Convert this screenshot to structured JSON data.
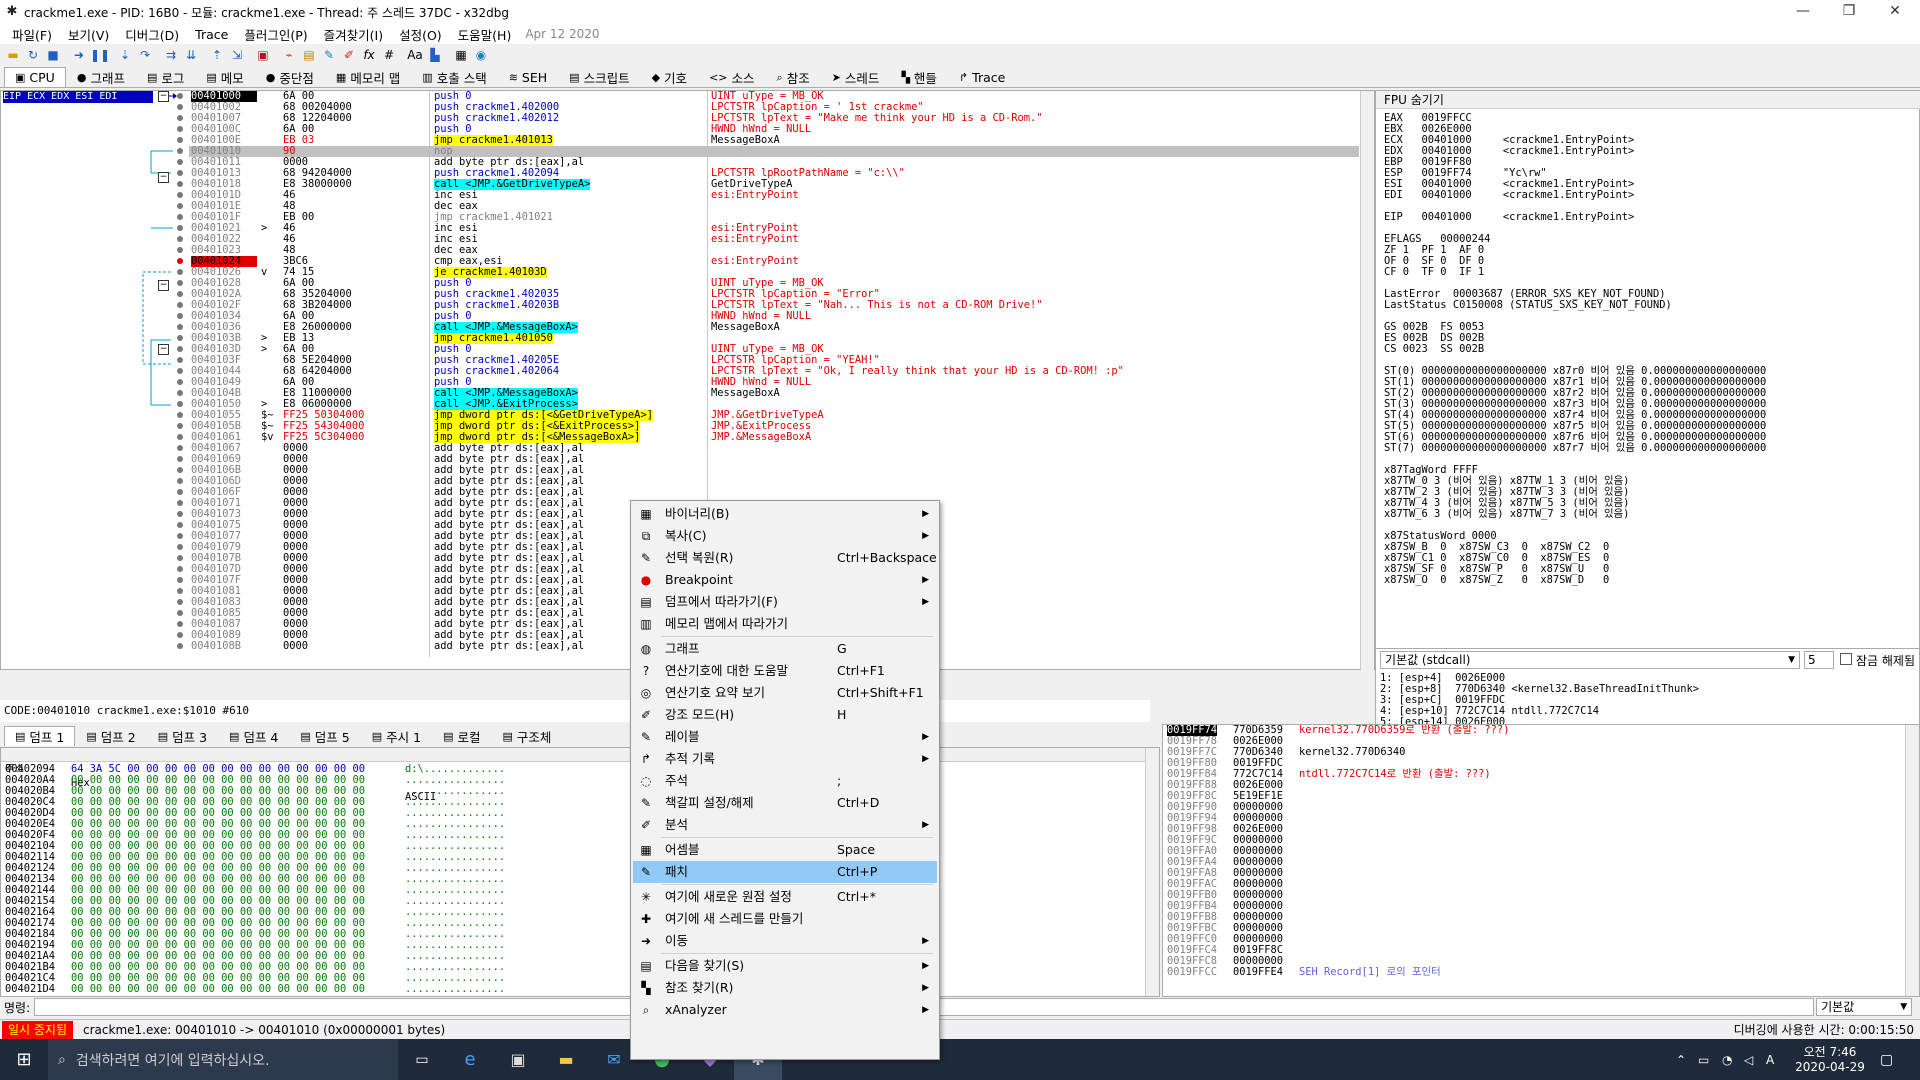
{
  "window": {
    "title": "crackme1.exe - PID: 16B0 - 모듈: crackme1.exe - Thread: 주 스레드 37DC - x32dbg",
    "min": "—",
    "max": "❐",
    "close": "✕"
  },
  "menu": {
    "items": [
      "파일(F)",
      "보기(V)",
      "디버그(D)",
      "Trace",
      "플러그인(P)",
      "즐겨찾기(I)",
      "설정(O)",
      "도움말(H)"
    ],
    "date": "Apr 12 2020"
  },
  "toolbar_icons": [
    "open-icon",
    "restart-icon",
    "stop-icon",
    "run-icon",
    "pause-icon",
    "step-into-icon",
    "step-over-icon",
    "trace-into-icon",
    "trace-over-icon",
    "execute-till-return-icon",
    "run-to-user-code-icon",
    "stop-sign-icon",
    "link-icon",
    "script-icon",
    "comment-icon",
    "label-icon",
    "function-icon",
    "hash-icon",
    "font-icon",
    "module-icon",
    "calc-icon",
    "globe-icon"
  ],
  "tabs": [
    {
      "label": "CPU",
      "icon": "▣"
    },
    {
      "label": "그래프",
      "icon": "●"
    },
    {
      "label": "로그",
      "icon": "▤"
    },
    {
      "label": "메모",
      "icon": "▤"
    },
    {
      "label": "중단점",
      "icon": "●"
    },
    {
      "label": "메모리 맵",
      "icon": "▦"
    },
    {
      "label": "호출 스택",
      "icon": "▥"
    },
    {
      "label": "SEH",
      "icon": "≋"
    },
    {
      "label": "스크립트",
      "icon": "▤"
    },
    {
      "label": "기호",
      "icon": "◆"
    },
    {
      "label": "소스",
      "icon": "<>"
    },
    {
      "label": "참조",
      "icon": "⌕"
    },
    {
      "label": "스레드",
      "icon": "➤"
    },
    {
      "label": "핸들",
      "icon": "▚"
    },
    {
      "label": "Trace",
      "icon": "↱"
    }
  ],
  "regs_label": "EIP ECX EDX ESI EDI",
  "disasm": [
    {
      "addr": "00401000",
      "bytes": "6A 00",
      "instr": "push 0",
      "cmt": "UINT uType = MB_OK",
      "eip": true
    },
    {
      "addr": "00401002",
      "bytes": "68 00204000",
      "instr": "push crackme1.402000",
      "cmt": "LPCTSTR lpCaption = ' 1st crackme\""
    },
    {
      "addr": "00401007",
      "bytes": "68 12204000",
      "instr": "push crackme1.402012",
      "cmt": "LPCTSTR lpText = \"Make me think your HD is a CD-Rom.\""
    },
    {
      "addr": "0040100C",
      "bytes": "6A 00",
      "instr": "push 0",
      "cmt": "HWND hWnd = NULL"
    },
    {
      "addr": "0040100E",
      "bytes": "EB 03",
      "instr": "jmp crackme1.401013",
      "cmt": "MessageBoxA",
      "red": true,
      "ph": true
    },
    {
      "addr": "00401010",
      "bytes": "90",
      "instr": "nop",
      "cmt": "",
      "sel": true,
      "red": true
    },
    {
      "addr": "00401011",
      "bytes": "0000",
      "instr": "add byte ptr ds:[eax],al",
      "cmt": ""
    },
    {
      "addr": "00401013",
      "bytes": "68 94204000",
      "instr": "push crackme1.402094",
      "cmt": "LPCTSTR lpRootPathName = \"c:\\\\\""
    },
    {
      "addr": "00401018",
      "bytes": "E8 38000000",
      "instr": "call <JMP.&GetDriveTypeA>",
      "cmt": "GetDriveTypeA",
      "call": true
    },
    {
      "addr": "0040101D",
      "bytes": "46",
      "instr": "inc esi",
      "cmt": "esi:EntryPoint"
    },
    {
      "addr": "0040101E",
      "bytes": "48",
      "instr": "dec eax",
      "cmt": ""
    },
    {
      "addr": "0040101F",
      "bytes": "EB 00",
      "instr": "jmp crackme1.401021",
      "cmt": ""
    },
    {
      "addr": "00401021",
      "bytes": "46",
      "instr": "inc esi",
      "cmt": "esi:EntryPoint",
      "arrow": ">"
    },
    {
      "addr": "00401022",
      "bytes": "46",
      "instr": "inc esi",
      "cmt": "esi:EntryPoint"
    },
    {
      "addr": "00401023",
      "bytes": "48",
      "instr": "dec eax",
      "cmt": ""
    },
    {
      "addr": "00401024",
      "bytes": "3BC6",
      "instr": "cmp eax,esi",
      "cmt": "esi:EntryPoint",
      "bp": true
    },
    {
      "addr": "00401026",
      "bytes": "74 15",
      "instr": "je crackme1.40103D",
      "cmt": "",
      "arrow": "v",
      "ph": true
    },
    {
      "addr": "00401028",
      "bytes": "6A 00",
      "instr": "push 0",
      "cmt": "UINT uType = MB_OK"
    },
    {
      "addr": "0040102A",
      "bytes": "68 35204000",
      "instr": "push crackme1.402035",
      "cmt": "LPCTSTR lpCaption = \"Error\""
    },
    {
      "addr": "0040102F",
      "bytes": "68 3B204000",
      "instr": "push crackme1.40203B",
      "cmt": "LPCTSTR lpText = \"Nah... This is not a CD-ROM Drive!\""
    },
    {
      "addr": "00401034",
      "bytes": "6A 00",
      "instr": "push 0",
      "cmt": "HWND hWnd = NULL"
    },
    {
      "addr": "00401036",
      "bytes": "E8 26000000",
      "instr": "call <JMP.&MessageBoxA>",
      "cmt": "MessageBoxA",
      "call": true
    },
    {
      "addr": "0040103B",
      "bytes": "EB 13",
      "instr": "jmp crackme1.401050",
      "cmt": "",
      "arrow": ">",
      "ph": true
    },
    {
      "addr": "0040103D",
      "bytes": "6A 00",
      "instr": "push 0",
      "cmt": "UINT uType = MB_OK",
      "arrow": ">"
    },
    {
      "addr": "0040103F",
      "bytes": "68 5E204000",
      "instr": "push crackme1.40205E",
      "cmt": "LPCTSTR lpCaption = \"YEAH!\""
    },
    {
      "addr": "00401044",
      "bytes": "68 64204000",
      "instr": "push crackme1.402064",
      "cmt": "LPCTSTR lpText = \"Ok, I really think that your HD is a CD-ROM! :p\""
    },
    {
      "addr": "00401049",
      "bytes": "6A 00",
      "instr": "push 0",
      "cmt": "HWND hWnd = NULL"
    },
    {
      "addr": "0040104B",
      "bytes": "E8 11000000",
      "instr": "call <JMP.&MessageBoxA>",
      "cmt": "MessageBoxA",
      "call": true
    },
    {
      "addr": "00401050",
      "bytes": "E8 06000000",
      "instr": "call <JMP.&ExitProcess>",
      "cmt": "",
      "arrow": ">",
      "call": true
    },
    {
      "addr": "00401055",
      "bytes": "FF25 50304000",
      "instr": "jmp dword ptr ds:[<&GetDriveTypeA>]",
      "cmt": "JMP.&GetDriveTypeA",
      "red": true,
      "arrow": "$~",
      "ph": true,
      "redcmt": true
    },
    {
      "addr": "0040105B",
      "bytes": "FF25 54304000",
      "instr": "jmp dword ptr ds:[<&ExitProcess>]",
      "cmt": "JMP.&ExitProcess",
      "red": true,
      "arrow": "$~",
      "ph": true,
      "redcmt": true
    },
    {
      "addr": "00401061",
      "bytes": "FF25 5C304000",
      "instr": "jmp dword ptr ds:[<&MessageBoxA>]",
      "cmt": "JMP.&MessageBoxA",
      "red": true,
      "arrow": "$v",
      "ph": true,
      "redcmt": true
    },
    {
      "addr": "00401067",
      "bytes": "0000",
      "instr": "add byte ptr ds:[eax],al",
      "cmt": ""
    },
    {
      "addr": "00401069",
      "bytes": "0000",
      "instr": "add byte ptr ds:[eax],al",
      "cmt": ""
    },
    {
      "addr": "0040106B",
      "bytes": "0000",
      "instr": "add byte ptr ds:[eax],al",
      "cmt": ""
    },
    {
      "addr": "0040106D",
      "bytes": "0000",
      "instr": "add byte ptr ds:[eax],al",
      "cmt": ""
    },
    {
      "addr": "0040106F",
      "bytes": "0000",
      "instr": "add byte ptr ds:[eax],al",
      "cmt": ""
    },
    {
      "addr": "00401071",
      "bytes": "0000",
      "instr": "add byte ptr ds:[eax],al",
      "cmt": ""
    },
    {
      "addr": "00401073",
      "bytes": "0000",
      "instr": "add byte ptr ds:[eax],al",
      "cmt": ""
    },
    {
      "addr": "00401075",
      "bytes": "0000",
      "instr": "add byte ptr ds:[eax],al",
      "cmt": ""
    },
    {
      "addr": "00401077",
      "bytes": "0000",
      "instr": "add byte ptr ds:[eax],al",
      "cmt": ""
    },
    {
      "addr": "00401079",
      "bytes": "0000",
      "instr": "add byte ptr ds:[eax],al",
      "cmt": ""
    },
    {
      "addr": "0040107B",
      "bytes": "0000",
      "instr": "add byte ptr ds:[eax],al",
      "cmt": ""
    },
    {
      "addr": "0040107D",
      "bytes": "0000",
      "instr": "add byte ptr ds:[eax],al",
      "cmt": ""
    },
    {
      "addr": "0040107F",
      "bytes": "0000",
      "instr": "add byte ptr ds:[eax],al",
      "cmt": ""
    },
    {
      "addr": "00401081",
      "bytes": "0000",
      "instr": "add byte ptr ds:[eax],al",
      "cmt": ""
    },
    {
      "addr": "00401083",
      "bytes": "0000",
      "instr": "add byte ptr ds:[eax],al",
      "cmt": ""
    },
    {
      "addr": "00401085",
      "bytes": "0000",
      "instr": "add byte ptr ds:[eax],al",
      "cmt": ""
    },
    {
      "addr": "00401087",
      "bytes": "0000",
      "instr": "add byte ptr ds:[eax],al",
      "cmt": ""
    },
    {
      "addr": "00401089",
      "bytes": "0000",
      "instr": "add byte ptr ds:[eax],al",
      "cmt": ""
    },
    {
      "addr": "0040108B",
      "bytes": "0000",
      "instr": "add byte ptr ds:[eax],al",
      "cmt": ""
    }
  ],
  "fpu": {
    "header": "FPU 숨기기",
    "lines": [
      "EAX   0019FFCC",
      "EBX   0026E000",
      "ECX   00401000     <crackme1.EntryPoint>",
      "EDX   00401000     <crackme1.EntryPoint>",
      "EBP   0019FF80",
      "ESP   0019FF74     \"Yc\\rw\"",
      "ESI   00401000     <crackme1.EntryPoint>",
      "EDI   00401000     <crackme1.EntryPoint>",
      "",
      "EIP   00401000     <crackme1.EntryPoint>",
      "",
      "EFLAGS   00000244",
      "ZF 1  PF 1  AF 0",
      "OF 0  SF 0  DF 0",
      "CF 0  TF 0  IF 1",
      "",
      "LastError  00003687 (ERROR_SXS_KEY_NOT_FOUND)",
      "LastStatus C0150008 (STATUS_SXS_KEY_NOT_FOUND)",
      "",
      "GS 002B  FS 0053",
      "ES 002B  DS 002B",
      "CS 0023  SS 002B",
      "",
      "ST(0) 00000000000000000000 x87r0 비어 있음 0.000000000000000000",
      "ST(1) 00000000000000000000 x87r1 비어 있음 0.000000000000000000",
      "ST(2) 00000000000000000000 x87r2 비어 있음 0.000000000000000000",
      "ST(3) 00000000000000000000 x87r3 비어 있음 0.000000000000000000",
      "ST(4) 00000000000000000000 x87r4 비어 있음 0.000000000000000000",
      "ST(5) 00000000000000000000 x87r5 비어 있음 0.000000000000000000",
      "ST(6) 00000000000000000000 x87r6 비어 있음 0.000000000000000000",
      "ST(7) 00000000000000000000 x87r7 비어 있음 0.000000000000000000",
      "",
      "x87TagWord FFFF",
      "x87TW_0 3 (비어 있음) x87TW_1 3 (비어 있음)",
      "x87TW_2 3 (비어 있음) x87TW_3 3 (비어 있음)",
      "x87TW_4 3 (비어 있음) x87TW_5 3 (비어 있음)",
      "x87TW_6 3 (비어 있음) x87TW_7 3 (비어 있음)",
      "",
      "x87StatusWord 0000",
      "x87SW_B  0  x87SW_C3  0  x87SW_C2  0",
      "x87SW_C1 0  x87SW_C0  0  x87SW_ES  0",
      "x87SW_SF 0  x87SW_P   0  x87SW_U   0",
      "x87SW_O  0  x87SW_Z   0  x87SW_D   0"
    ]
  },
  "callconv": {
    "value": "기본값 (stdcall)",
    "count": "5",
    "unlock": "잠금 해제됨"
  },
  "args": [
    "1: [esp+4]  0026E000",
    "2: [esp+8]  770D6340 <kernel32.BaseThreadInitThunk>",
    "3: [esp+C]  0019FFDC",
    "4: [esp+10] 772C7C14 ntdll.772C7C14",
    "5: [esp+14] 0026E000"
  ],
  "code_status": "CODE:00401010 crackme1.exe:$1010 #610",
  "dumptabs": [
    "덤프 1",
    "덤프 2",
    "덤프 3",
    "덤프 4",
    "덤프 5",
    "주시 1",
    "로컬",
    "구조체"
  ],
  "dump": {
    "headers": [
      "주소",
      "Hex",
      "ASCII"
    ],
    "rows": [
      {
        "addr": "00402094",
        "hex": "64 3A 5C 00 00 00 00 00 00 00 00 00 00 00 00 00",
        "ascii": "d:\\............."
      },
      {
        "addr": "004020A4",
        "hex": "00 00 00 00 00 00 00 00 00 00 00 00 00 00 00 00",
        "ascii": "................"
      },
      {
        "addr": "004020B4",
        "hex": "00 00 00 00 00 00 00 00 00 00 00 00 00 00 00 00",
        "ascii": "................"
      },
      {
        "addr": "004020C4",
        "hex": "00 00 00 00 00 00 00 00 00 00 00 00 00 00 00 00",
        "ascii": "................"
      },
      {
        "addr": "004020D4",
        "hex": "00 00 00 00 00 00 00 00 00 00 00 00 00 00 00 00",
        "ascii": "................"
      },
      {
        "addr": "004020E4",
        "hex": "00 00 00 00 00 00 00 00 00 00 00 00 00 00 00 00",
        "ascii": "................"
      },
      {
        "addr": "004020F4",
        "hex": "00 00 00 00 00 00 00 00 00 00 00 00 00 00 00 00",
        "ascii": "................"
      },
      {
        "addr": "00402104",
        "hex": "00 00 00 00 00 00 00 00 00 00 00 00 00 00 00 00",
        "ascii": "................"
      },
      {
        "addr": "00402114",
        "hex": "00 00 00 00 00 00 00 00 00 00 00 00 00 00 00 00",
        "ascii": "................"
      },
      {
        "addr": "00402124",
        "hex": "00 00 00 00 00 00 00 00 00 00 00 00 00 00 00 00",
        "ascii": "................"
      },
      {
        "addr": "00402134",
        "hex": "00 00 00 00 00 00 00 00 00 00 00 00 00 00 00 00",
        "ascii": "................"
      },
      {
        "addr": "00402144",
        "hex": "00 00 00 00 00 00 00 00 00 00 00 00 00 00 00 00",
        "ascii": "................"
      },
      {
        "addr": "00402154",
        "hex": "00 00 00 00 00 00 00 00 00 00 00 00 00 00 00 00",
        "ascii": "................"
      },
      {
        "addr": "00402164",
        "hex": "00 00 00 00 00 00 00 00 00 00 00 00 00 00 00 00",
        "ascii": "................"
      },
      {
        "addr": "00402174",
        "hex": "00 00 00 00 00 00 00 00 00 00 00 00 00 00 00 00",
        "ascii": "................"
      },
      {
        "addr": "00402184",
        "hex": "00 00 00 00 00 00 00 00 00 00 00 00 00 00 00 00",
        "ascii": "................"
      },
      {
        "addr": "00402194",
        "hex": "00 00 00 00 00 00 00 00 00 00 00 00 00 00 00 00",
        "ascii": "................"
      },
      {
        "addr": "004021A4",
        "hex": "00 00 00 00 00 00 00 00 00 00 00 00 00 00 00 00",
        "ascii": "................"
      },
      {
        "addr": "004021B4",
        "hex": "00 00 00 00 00 00 00 00 00 00 00 00 00 00 00 00",
        "ascii": "................"
      },
      {
        "addr": "004021C4",
        "hex": "00 00 00 00 00 00 00 00 00 00 00 00 00 00 00 00",
        "ascii": "................"
      },
      {
        "addr": "004021D4",
        "hex": "00 00 00 00 00 00 00 00 00 00 00 00 00 00 00 00",
        "ascii": "................"
      }
    ]
  },
  "stack": [
    {
      "addr": "0019FF74",
      "val": "770D6359",
      "cmt": "kernel32.770D6359로 반환 (출발: ???)",
      "cur": true,
      "red": true
    },
    {
      "addr": "0019FF78",
      "val": "0026E000",
      "cmt": ""
    },
    {
      "addr": "0019FF7C",
      "val": "770D6340",
      "cmt": "kernel32.770D6340"
    },
    {
      "addr": "0019FF80",
      "val": "0019FFDC",
      "cmt": ""
    },
    {
      "addr": "0019FF84",
      "val": "772C7C14",
      "cmt": "ntdll.772C7C14로 반환 (출발: ???)",
      "red": true
    },
    {
      "addr": "0019FF88",
      "val": "0026E000",
      "cmt": ""
    },
    {
      "addr": "0019FF8C",
      "val": "5E19EF1E",
      "cmt": ""
    },
    {
      "addr": "0019FF90",
      "val": "00000000",
      "cmt": ""
    },
    {
      "addr": "0019FF94",
      "val": "00000000",
      "cmt": ""
    },
    {
      "addr": "0019FF98",
      "val": "0026E000",
      "cmt": ""
    },
    {
      "addr": "0019FF9C",
      "val": "00000000",
      "cmt": ""
    },
    {
      "addr": "0019FFA0",
      "val": "00000000",
      "cmt": ""
    },
    {
      "addr": "0019FFA4",
      "val": "00000000",
      "cmt": ""
    },
    {
      "addr": "0019FFA8",
      "val": "00000000",
      "cmt": ""
    },
    {
      "addr": "0019FFAC",
      "val": "00000000",
      "cmt": ""
    },
    {
      "addr": "0019FFB0",
      "val": "00000000",
      "cmt": ""
    },
    {
      "addr": "0019FFB4",
      "val": "00000000",
      "cmt": ""
    },
    {
      "addr": "0019FFB8",
      "val": "00000000",
      "cmt": ""
    },
    {
      "addr": "0019FFBC",
      "val": "00000000",
      "cmt": ""
    },
    {
      "addr": "0019FFC0",
      "val": "00000000",
      "cmt": ""
    },
    {
      "addr": "0019FFC4",
      "val": "0019FF8C",
      "cmt": ""
    },
    {
      "addr": "0019FFC8",
      "val": "00000000",
      "cmt": ""
    },
    {
      "addr": "0019FFCC",
      "val": "0019FFE4",
      "cmt": "SEH Record[1] 로의 포인터",
      "blue": true
    }
  ],
  "cmd": {
    "label": "명령:",
    "value": "",
    "mode": "기본값"
  },
  "status": {
    "state": "일시 중지됨",
    "msg": "crackme1.exe: 00401010 -> 00401010 (0x00000001 bytes)",
    "time": "디버깅에 사용한 시간: 0:00:15:50"
  },
  "context_menu": [
    {
      "icon": "▦",
      "label": "바이너리(B)",
      "shortcut": "",
      "sub": true
    },
    {
      "icon": "⧉",
      "label": "복사(C)",
      "shortcut": "",
      "sub": true
    },
    {
      "icon": "✎",
      "label": "선택 복원(R)",
      "shortcut": "Ctrl+Backspace",
      "sub": false
    },
    {
      "icon": "●",
      "label": "Breakpoint",
      "shortcut": "",
      "sub": true
    },
    {
      "icon": "▤",
      "label": "덤프에서 따라가기(F)",
      "shortcut": "",
      "sub": true
    },
    {
      "icon": "▥",
      "label": "메모리 맵에서 따라가기",
      "shortcut": "",
      "sub": false
    },
    {
      "icon": "◍",
      "label": "그래프",
      "shortcut": "G",
      "sub": false
    },
    {
      "icon": "?",
      "label": "연산기호에 대한 도움말",
      "shortcut": "Ctrl+F1",
      "sub": false
    },
    {
      "icon": "◎",
      "label": "연산기호 요약 보기",
      "shortcut": "Ctrl+Shift+F1",
      "sub": false
    },
    {
      "icon": "✐",
      "label": "강조 모드(H)",
      "shortcut": "H",
      "sub": false
    },
    {
      "icon": "✎",
      "label": "레이블",
      "shortcut": "",
      "sub": true
    },
    {
      "icon": "↱",
      "label": "추적 기록",
      "shortcut": "",
      "sub": true
    },
    {
      "icon": "◌",
      "label": "주석",
      "shortcut": ";",
      "sub": false
    },
    {
      "icon": "✎",
      "label": "책갈피 설정/해제",
      "shortcut": "Ctrl+D",
      "sub": false
    },
    {
      "icon": "✐",
      "label": "분석",
      "shortcut": "",
      "sub": true
    },
    {
      "icon": "▦",
      "label": "어셈블",
      "shortcut": "Space",
      "sub": false
    },
    {
      "icon": "✎",
      "label": "패치",
      "shortcut": "Ctrl+P",
      "sub": false,
      "hl": true
    },
    {
      "icon": "✳",
      "label": "여기에 새로운 원점 설정",
      "shortcut": "Ctrl+*",
      "sub": false
    },
    {
      "icon": "✚",
      "label": "여기에 새 스레드를 만들기",
      "shortcut": "",
      "sub": false
    },
    {
      "icon": "➜",
      "label": "이동",
      "shortcut": "",
      "sub": true
    },
    {
      "icon": "▤",
      "label": "다음을 찾기(S)",
      "shortcut": "",
      "sub": true
    },
    {
      "icon": "▚",
      "label": "참조 찾기(R)",
      "shortcut": "",
      "sub": true
    },
    {
      "icon": "⌕",
      "label": "xAnalyzer",
      "shortcut": "",
      "sub": true
    }
  ],
  "taskbar": {
    "search": "검색하려면 여기에 입력하십시오.",
    "time": "오전 7:46",
    "date": "2020-04-29"
  }
}
